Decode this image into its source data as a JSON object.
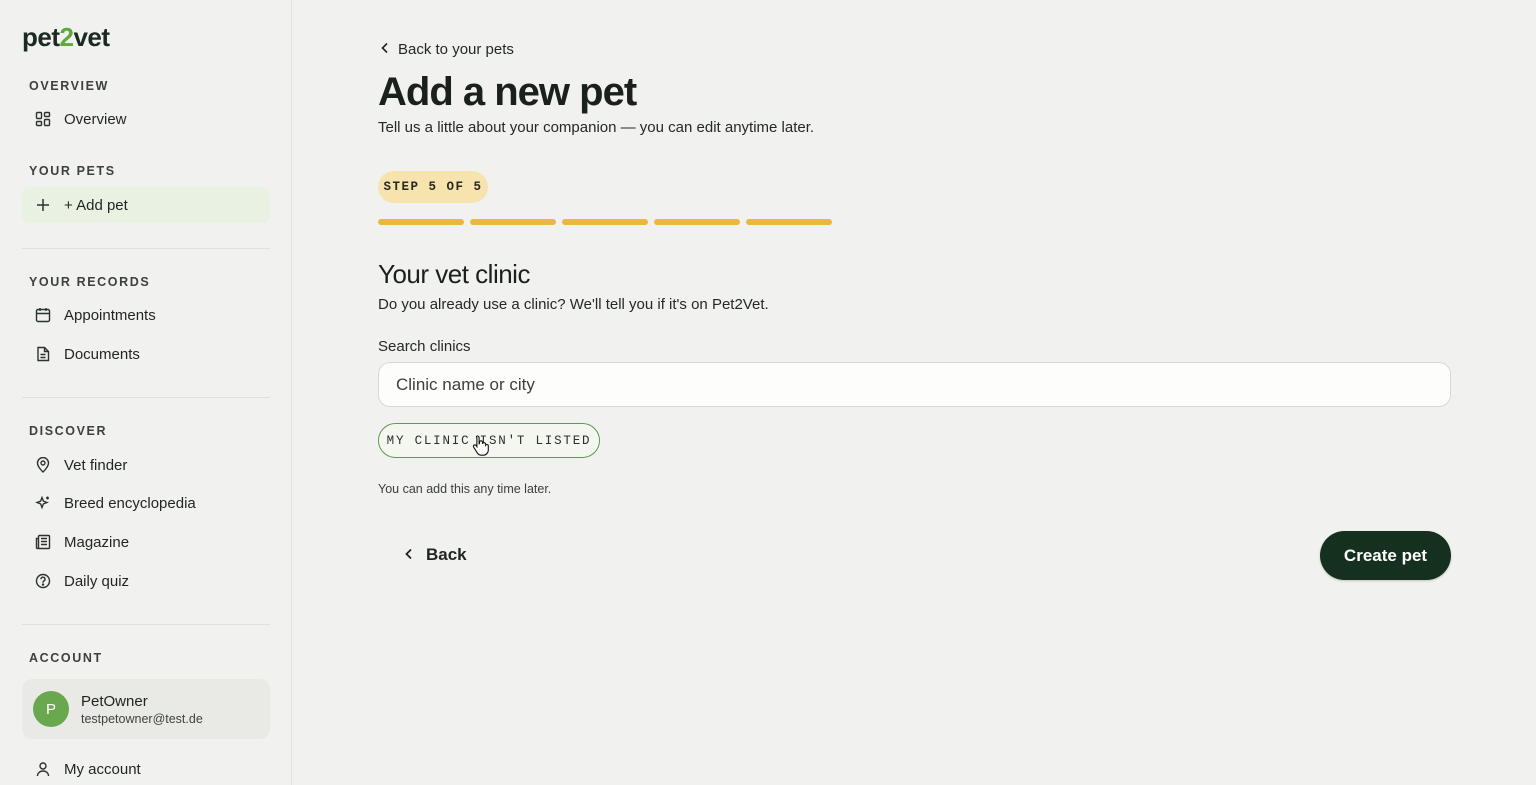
{
  "brand": {
    "logo_prefix": "pet",
    "logo_accent": "2",
    "logo_suffix": "vet"
  },
  "sidebar": {
    "sections": {
      "overview": "OVERVIEW",
      "your_pets": "YOUR PETS",
      "your_records": "YOUR RECORDS",
      "discover": "DISCOVER",
      "account": "ACCOUNT"
    },
    "items": {
      "overview": {
        "label": "Overview",
        "icon": "grid-icon"
      },
      "add_pet": {
        "label": "+ Add pet",
        "icon": "plus-icon",
        "active": true
      },
      "appointments": {
        "label": "Appointments",
        "icon": "calendar-icon"
      },
      "documents": {
        "label": "Documents",
        "icon": "document-icon"
      },
      "vet_finder": {
        "label": "Vet finder",
        "icon": "map-pin-icon"
      },
      "breed_encyclopedia": {
        "label": "Breed encyclopedia",
        "icon": "sparkle-icon"
      },
      "magazine": {
        "label": "Magazine",
        "icon": "newspaper-icon"
      },
      "daily_quiz": {
        "label": "Daily quiz",
        "icon": "question-circle-icon"
      },
      "my_account": {
        "label": "My account",
        "icon": "user-icon"
      }
    },
    "account": {
      "avatar_initial": "P",
      "name": "PetOwner",
      "email": "testpetowner@test.de"
    }
  },
  "main": {
    "back_link": "Back to your pets",
    "title": "Add a new pet",
    "subtitle": "Tell us a little about your companion — you can edit anytime later.",
    "step_badge": "STEP 5 OF 5",
    "progress": {
      "current_step": 5,
      "total_steps": 5
    },
    "section_title": "Your vet clinic",
    "section_desc": "Do you already use a clinic? We'll tell you if it's on Pet2Vet.",
    "search": {
      "label": "Search clinics",
      "placeholder": "Clinic name or city",
      "value": ""
    },
    "not_listed_button": "MY CLINIC ISN'T LISTED",
    "hint": "You can add this any time later.",
    "back_button": "Back",
    "create_button": "Create pet"
  },
  "colors": {
    "brand_green": "#5fa83b",
    "primary_button": "#15301f",
    "progress": "#e9b93e",
    "step_badge_bg": "#f7e3ad",
    "active_nav_bg": "#e9f1e2",
    "avatar_bg": "#6aa84f"
  }
}
